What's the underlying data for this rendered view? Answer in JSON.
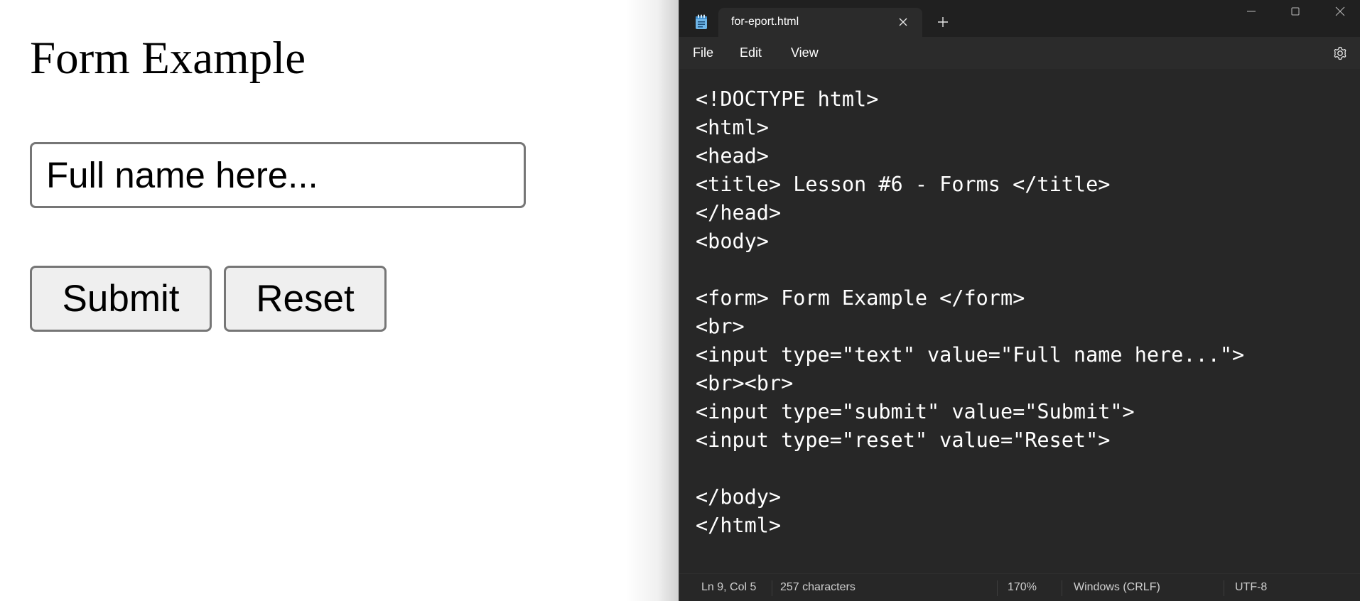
{
  "browser": {
    "form_title": "Form Example",
    "name_input_value": "Full name here...",
    "submit_label": "Submit",
    "reset_label": "Reset"
  },
  "notepad": {
    "tab_title": "for-eport.html",
    "menu": {
      "file": "File",
      "edit": "Edit",
      "view": "View"
    },
    "code_lines": [
      "<!DOCTYPE html>",
      "<html>",
      "<head>",
      "<title> Lesson #6 - Forms </title>",
      "</head>",
      "<body>",
      "",
      "<form> Form Example </form>",
      "<br>",
      "<input type=\"text\" value=\"Full name here...\">",
      "<br><br>",
      "<input type=\"submit\" value=\"Submit\">",
      "<input type=\"reset\" value=\"Reset\">",
      "",
      "</body>",
      "</html>"
    ],
    "status": {
      "position": "Ln 9, Col 5",
      "characters": "257 characters",
      "zoom": "170%",
      "line_ending": "Windows (CRLF)",
      "encoding": "UTF-8"
    },
    "icons": {
      "app": "notepad-icon",
      "tab_close": "close-icon",
      "new_tab": "plus-icon",
      "minimize": "minimize-icon",
      "maximize": "maximize-icon",
      "close": "close-icon",
      "settings": "gear-icon"
    },
    "colors": {
      "editor_bg": "#272727",
      "titlebar_bg": "#202020",
      "app_icon": "#6fb6e8"
    }
  }
}
